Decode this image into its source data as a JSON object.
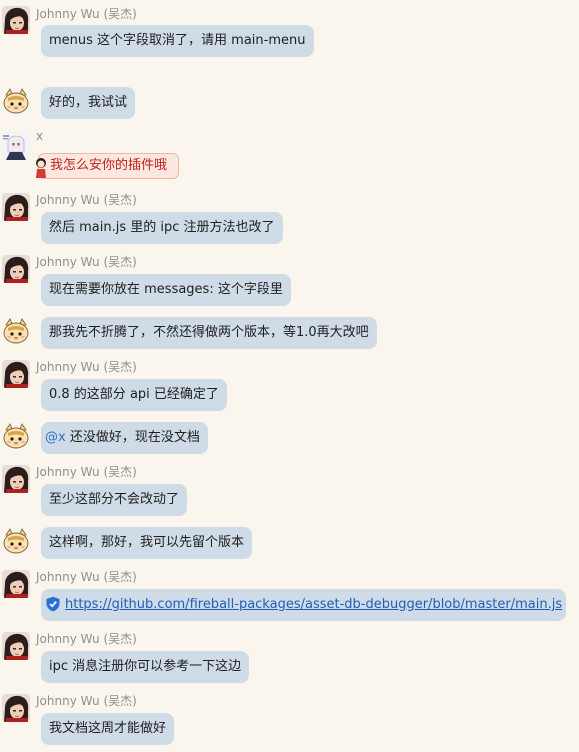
{
  "chat": {
    "sender_names": {
      "johnny": "Johnny Wu (吴杰)",
      "x": "x"
    },
    "messages": [
      {
        "sender": "Johnny Wu (吴杰)",
        "text": "menus 这个字段取消了，请用 main-menu"
      },
      {
        "sender": "",
        "text": "好的，我试试"
      },
      {
        "sender": "x",
        "text": "我怎么安你的插件哦"
      },
      {
        "sender": "Johnny Wu (吴杰)",
        "text": "然后 main.js 里的 ipc 注册方法也改了"
      },
      {
        "sender": "Johnny Wu (吴杰)",
        "text": "现在需要你放在 messages: 这个字段里"
      },
      {
        "sender": "",
        "text": "那我先不折腾了，不然还得做两个版本，等1.0再大改吧"
      },
      {
        "sender": "Johnny Wu (吴杰)",
        "text": "0.8 的这部分 api 已经确定了"
      },
      {
        "sender": "",
        "mention": "@x",
        "text": " 还没做好，现在没文档"
      },
      {
        "sender": "Johnny Wu (吴杰)",
        "text": "至少这部分不会改动了"
      },
      {
        "sender": "",
        "text": "这样啊，那好，我可以先留个版本"
      },
      {
        "sender": "Johnny Wu (吴杰)",
        "link": "https://github.com/fireball-packages/asset-db-debugger/blob/master/main.js"
      },
      {
        "sender": "Johnny Wu (吴杰)",
        "text": "ipc 消息注册你可以参考一下这边"
      },
      {
        "sender": "Johnny Wu (吴杰)",
        "text": "我文档这周才能做好"
      }
    ]
  },
  "colors": {
    "background": "#faf6ee",
    "bubble": "#cfdbe7",
    "sender_name": "#8f8f8f",
    "link": "#1d5fb8",
    "mention": "#2e74c6",
    "tag_text": "#c0211a"
  },
  "icons": {
    "johnny_avatar": "dark-haired-avatar-icon",
    "self_avatar": "cartoon-cat-avatar-icon",
    "x_avatar": "anime-character-avatar-icon",
    "link_shield": "shield-check-icon",
    "tag_doll": "doll-icon"
  }
}
